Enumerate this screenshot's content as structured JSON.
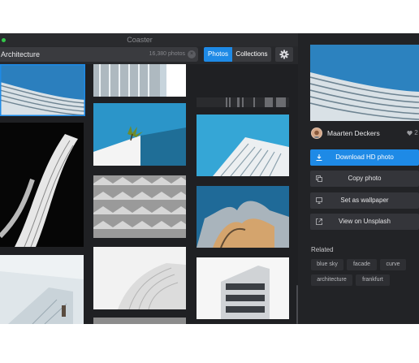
{
  "app": {
    "title": "Coaster"
  },
  "search": {
    "query": "Architecture",
    "count": "16,380 photos"
  },
  "tabs": [
    "Photos",
    "Collections"
  ],
  "icons": {
    "settings": "gear-icon",
    "clear": "clear-icon",
    "download": "download-icon",
    "copy": "copy-icon",
    "wallpaper": "monitor-icon",
    "external": "external-link-icon",
    "likes": "heart-icon"
  },
  "colors": {
    "accent": "#1e8ae6",
    "window_bg": "#1f2023",
    "sidebar_bg": "#222326"
  },
  "sidebar": {
    "author": "Maarten Deckers",
    "likes": "2",
    "buttons": [
      "Download HD photo",
      "Copy photo",
      "Set as wallpaper",
      "View on Unsplash"
    ],
    "related_title": "Related",
    "tags": [
      "blue sky",
      "facade",
      "curve",
      "architecture",
      "frankfurt"
    ]
  }
}
